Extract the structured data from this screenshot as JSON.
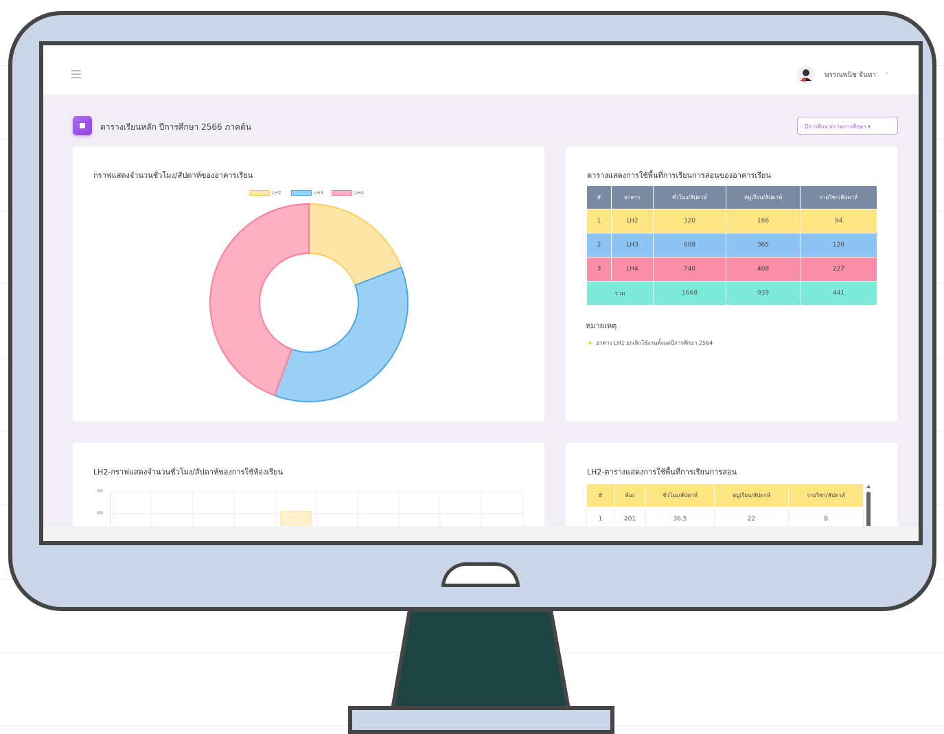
{
  "topbar": {
    "user_name": "พรรณพนิช จันทา"
  },
  "page": {
    "title": "ตารางเรียนหลัก ปีการศึกษา 2566 ภาคต้น",
    "year_button": "ปีการศึกษา/ภาคการศึกษา"
  },
  "donut_card": {
    "title": "กราฟแสดงจำนวนชั่วโมง/สัปดาห์ของอาคารเรียน",
    "chart_data": {
      "type": "pie",
      "categories": [
        "LH2",
        "LH3",
        "LH4"
      ],
      "values": [
        320,
        608,
        740
      ],
      "colors": [
        "#ffe6a8",
        "#9ccff5",
        "#ffb0c2"
      ],
      "border_colors": [
        "#ffcc59",
        "#4aa9ea",
        "#ff7f9b"
      ],
      "legend": "top"
    }
  },
  "building_table": {
    "title": "ตารางแสดงการใช้พื้นที่การเรียนการสอนของอาคารเรียน",
    "headers": [
      "#",
      "อาคาร",
      "ชั่วโมง/สัปดาห์",
      "หมู่เรียน/สัปดาห์",
      "รายวิชา/สัปดาห์"
    ],
    "rows": [
      [
        "1",
        "LH2",
        "320",
        "166",
        "94"
      ],
      [
        "2",
        "LH3",
        "608",
        "365",
        "120"
      ],
      [
        "3",
        "LH4",
        "740",
        "408",
        "227"
      ]
    ],
    "total": [
      "รวม",
      "1668",
      "939",
      "441"
    ],
    "header_color": "#7b8aa3",
    "row_colors": [
      "#ffe582",
      "#8ec4f5",
      "#f98ea6"
    ],
    "total_color": "#7eeada"
  },
  "note": {
    "heading": "หมายเหตุ",
    "text": "อาคาร LH1 ยกเลิกใช้งานตั้งแต่ปีการศึกษา 2564"
  },
  "lh2_chart": {
    "title": "LH2-กราฟแสดงจำนวนชั่วโมง/สัปดาห์ของการใช้ห้องเรียน",
    "y_ticks": [
      "45",
      "40"
    ]
  },
  "lh2_table": {
    "title": "LH2-ตารางแสดงการใช้พื้นที่การเรียนการสอน",
    "headers": [
      "#",
      "ห้อง",
      "ชั่วโมง/สัปดาห์",
      "หมู่เรียน/สัปดาห์",
      "รายวิชา/สัปดาห์"
    ],
    "rows": [
      [
        "1",
        "201",
        "36.5",
        "22",
        "8"
      ]
    ],
    "header_color": "#ffe582"
  }
}
